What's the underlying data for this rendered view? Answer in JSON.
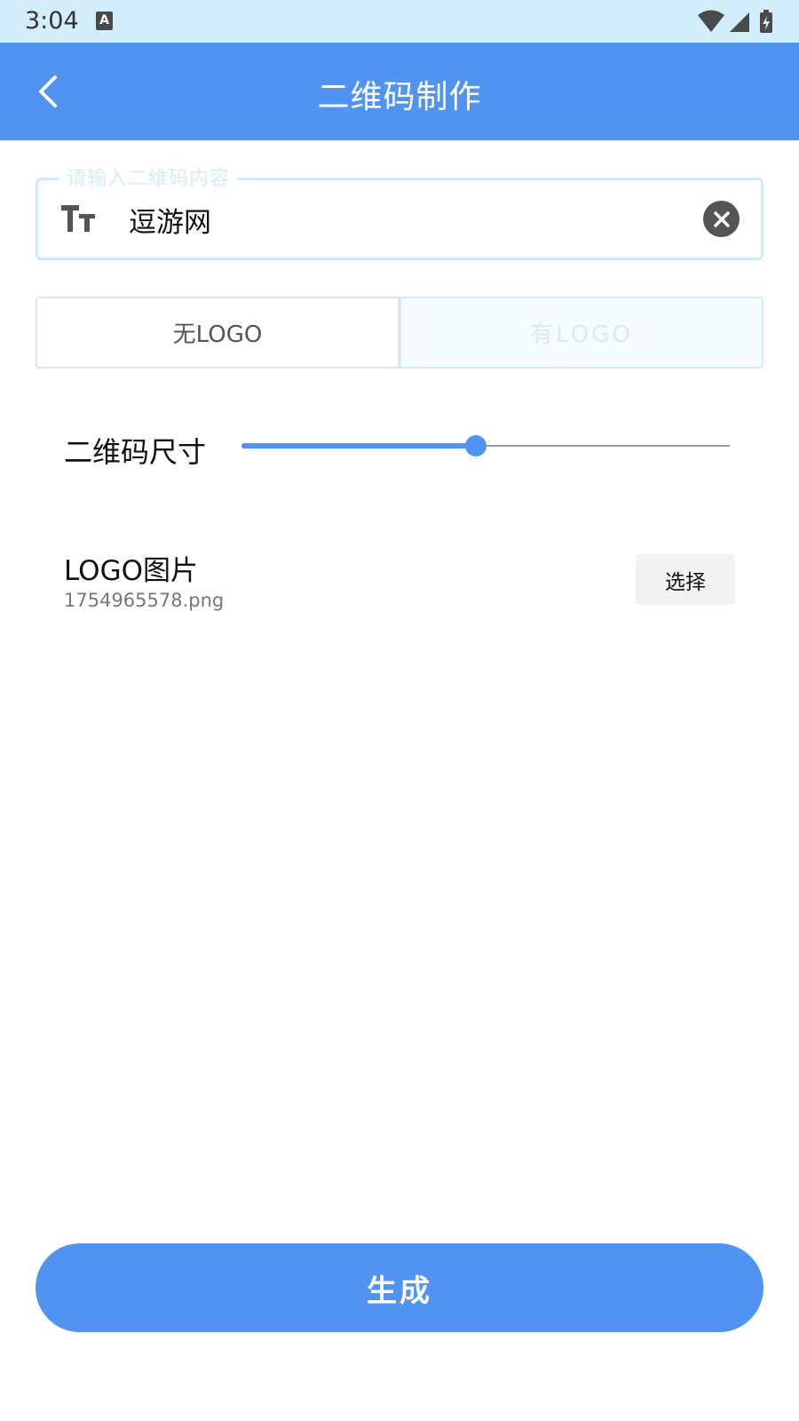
{
  "status_bar": {
    "time": "3:04",
    "notification_icon": "keyboard-a-icon",
    "notification_label": "A",
    "icons": [
      "wifi-icon",
      "cell-signal-icon",
      "battery-charging-icon"
    ]
  },
  "app_bar": {
    "title": "二维码制作",
    "back_icon": "chevron-left-icon",
    "color": "#5093f0"
  },
  "content_input": {
    "placeholder": "请输入二维码内容",
    "value": "逗游网",
    "leading_icon": "text-size-icon",
    "trailing_icon": "clear-icon"
  },
  "logo_toggle": {
    "options": [
      "无LOGO",
      "有LOGO"
    ],
    "selected_index": 0
  },
  "size_slider": {
    "label": "二维码尺寸",
    "value_fraction": 0.48
  },
  "logo_picker": {
    "title": "LOGO图片",
    "filename": "1754965578.png",
    "button_label": "选择"
  },
  "generate_button": {
    "label": "生成"
  },
  "colors": {
    "accent": "#5093f0",
    "status_bar_bg": "#d3eefb",
    "outline_light": "#cfeafa"
  }
}
